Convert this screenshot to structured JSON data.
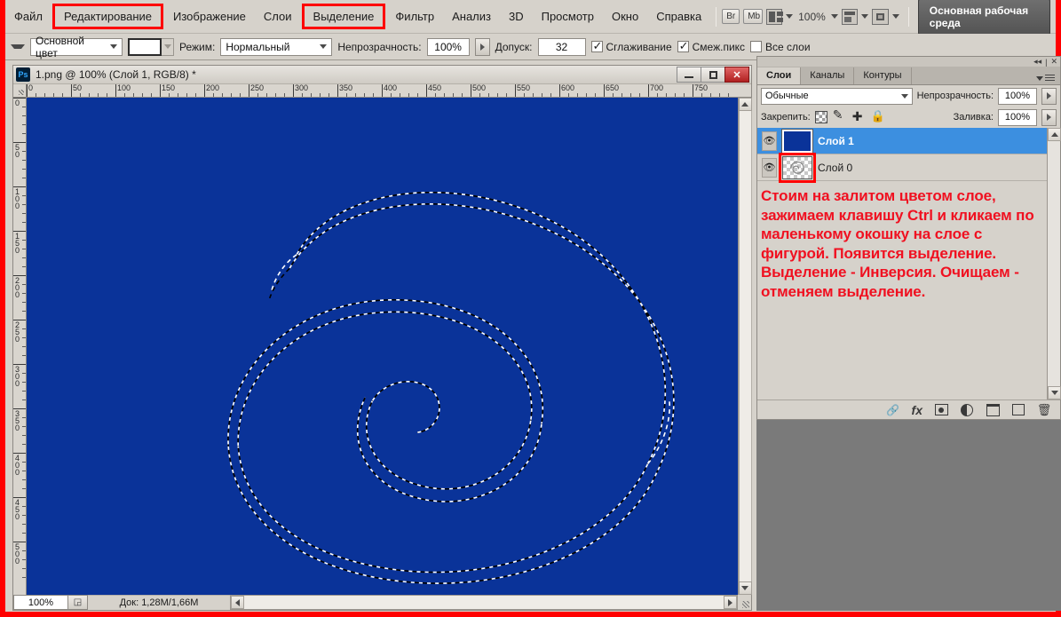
{
  "menubar": {
    "items": [
      {
        "label": "Файл",
        "boxed": false
      },
      {
        "label": "Редактирование",
        "boxed": true
      },
      {
        "label": "Изображение",
        "boxed": false
      },
      {
        "label": "Слои",
        "boxed": false
      },
      {
        "label": "Выделение",
        "boxed": true
      },
      {
        "label": "Фильтр",
        "boxed": false
      },
      {
        "label": "Анализ",
        "boxed": false
      },
      {
        "label": "3D",
        "boxed": false
      },
      {
        "label": "Просмотр",
        "boxed": false
      },
      {
        "label": "Окно",
        "boxed": false
      },
      {
        "label": "Справка",
        "boxed": false
      }
    ],
    "bridge_label": "Br",
    "mini_bridge_label": "Mb",
    "zoom_level": "100%",
    "workspace_label": "Основная рабочая среда",
    "icons": {
      "arrange": "arrange-documents-icon",
      "screen_mode": "screen-mode-icon",
      "view_extras": "view-extras-icon"
    }
  },
  "options": {
    "fill_source_label": "Основной цвет",
    "mode_label": "Режим:",
    "mode_value": "Нормальный",
    "opacity_label": "Непрозрачность:",
    "opacity_value": "100%",
    "tolerance_label": "Допуск:",
    "tolerance_value": "32",
    "antialias_label": "Сглаживание",
    "antialias_checked": true,
    "contiguous_label": "Смеж.пикс",
    "contiguous_checked": true,
    "alllayers_label": "Все слои",
    "alllayers_checked": false
  },
  "document": {
    "title": "1.png @ 100% (Слой 1, RGB/8) *",
    "ps_badge": "Ps",
    "window_buttons": {
      "minimize": "minimize-button",
      "maximize": "maximize-button",
      "close": "✕"
    },
    "ruler_labels_h": [
      "0",
      "50",
      "100",
      "150",
      "200",
      "250",
      "300",
      "350",
      "400",
      "450",
      "500",
      "550",
      "600",
      "650",
      "700",
      "750"
    ],
    "ruler_labels_v": [
      "0",
      "50",
      "100",
      "150",
      "200",
      "250",
      "300",
      "350",
      "400",
      "450",
      "500"
    ],
    "canvas_color": "#0a3399",
    "selection_description": "marching-ants spiral selection"
  },
  "statusbar": {
    "zoom_value": "100%",
    "doc_info": "Док: 1,28М/1,66М"
  },
  "panel": {
    "collapse_icon": "◂◂",
    "close_icon": "✕",
    "tabs": [
      {
        "label": "Слои",
        "active": true
      },
      {
        "label": "Каналы",
        "active": false
      },
      {
        "label": "Контуры",
        "active": false
      }
    ],
    "blend_mode": "Обычные",
    "opacity_label": "Непрозрачность:",
    "opacity_value": "100%",
    "lock_label": "Закрепить:",
    "fill_label": "Заливка:",
    "fill_value": "100%",
    "layers": [
      {
        "name": "Слой 1",
        "selected": true,
        "thumb": "solid-blue",
        "highlight": false
      },
      {
        "name": "Слой 0",
        "selected": false,
        "thumb": "spiral-transparent",
        "highlight": true
      }
    ],
    "annotation": "Стоим на залитом цветом слое, зажимаем клавишу Ctrl и кликаем по маленькому окошку на слое с фигурой. Появится выделение. Выделение - Инверсия. Очищаем - отменяем выделение.",
    "footer_icons": [
      "link-layers-icon",
      "layer-style-fx-icon",
      "add-layer-mask-icon",
      "adjustment-layer-icon",
      "new-group-folder-icon",
      "new-layer-icon",
      "delete-layer-trash-icon"
    ],
    "fx_label": "fx"
  }
}
